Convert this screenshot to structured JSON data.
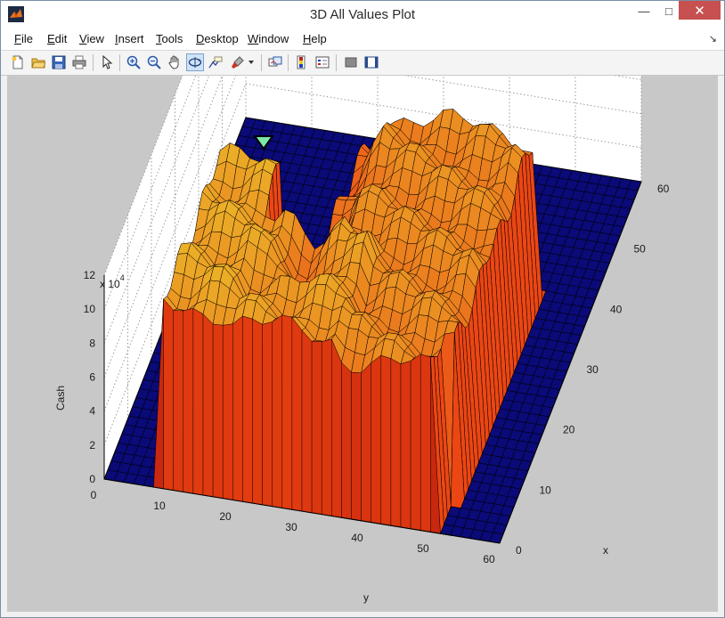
{
  "window": {
    "title": "3D All Values Plot"
  },
  "window_controls": {
    "minimize": "—",
    "maximize": "□",
    "close": "✕"
  },
  "menu": [
    {
      "label": "File",
      "key": "F",
      "rest": "ile"
    },
    {
      "label": "Edit",
      "key": "E",
      "rest": "dit"
    },
    {
      "label": "View",
      "key": "V",
      "rest": "iew"
    },
    {
      "label": "Insert",
      "key": "I",
      "rest": "nsert"
    },
    {
      "label": "Tools",
      "key": "T",
      "rest": "ools"
    },
    {
      "label": "Desktop",
      "key": "D",
      "rest": "esktop"
    },
    {
      "label": "Window",
      "key": "W",
      "rest": "indow"
    },
    {
      "label": "Help",
      "key": "H",
      "rest": "elp"
    }
  ],
  "toolbar": {
    "icons": [
      "new-figure-icon",
      "open-file-icon",
      "save-icon",
      "print-icon",
      "pointer-icon",
      "zoom-in-icon",
      "zoom-out-icon",
      "pan-hand-icon",
      "rotate-3d-icon",
      "data-cursor-icon",
      "brush-icon",
      "link-plot-icon",
      "colorbar-icon",
      "legend-icon",
      "hide-plot-tools-icon",
      "show-plot-tools-icon"
    ],
    "active": "rotate-3d-icon"
  },
  "colors": {
    "surface_top": "#f08a1c",
    "surface_wall": "#e03a12",
    "floor": "#0a0a78",
    "figure_bg": "#c8c8c8",
    "marker": "#7de8a8"
  },
  "chart_data": {
    "type": "surface",
    "zlabel": "Cash",
    "xlabel": "x",
    "ylabel": "y",
    "z_exponent": "x 10",
    "z_exponent_power": "4",
    "zticks": [
      "0",
      "2",
      "4",
      "6",
      "8",
      "10",
      "12"
    ],
    "xticks": [
      "0",
      "10",
      "20",
      "30",
      "40",
      "50",
      "60"
    ],
    "yticks": [
      "0",
      "10",
      "20",
      "30",
      "40",
      "50",
      "60"
    ],
    "zlim": [
      0,
      120000
    ],
    "xlim": [
      0,
      60
    ],
    "ylim": [
      0,
      60
    ],
    "grid": true,
    "plateau_regions": [
      {
        "x": [
          0,
          25
        ],
        "y": [
          8,
          18
        ],
        "z": 110000
      },
      {
        "x": [
          0,
          18
        ],
        "y": [
          18,
          35
        ],
        "z": 105000
      },
      {
        "x": [
          0,
          40
        ],
        "y": [
          25,
          50
        ],
        "z": 95000
      },
      {
        "x": [
          5,
          40
        ],
        "y": [
          30,
          52
        ],
        "z": 90000
      }
    ],
    "maximum_marker": {
      "x": 0,
      "y": 13,
      "z": 120000
    }
  }
}
